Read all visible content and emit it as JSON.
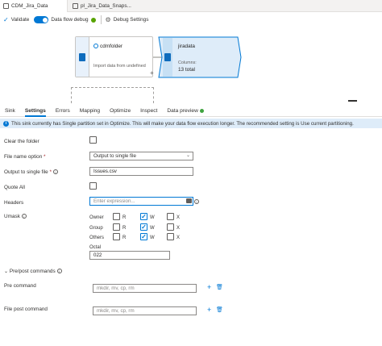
{
  "doc_tabs": [
    {
      "label": "CDM_Jira_Data"
    },
    {
      "label": "pl_Jira_Data_Snaps..."
    }
  ],
  "toolbar": {
    "validate_label": "Validate",
    "data_flow_debug_label": "Data flow debug",
    "debug_settings_label": "Debug Settings"
  },
  "canvas": {
    "source_node": {
      "title": "cdmfolder",
      "subtitle": "Import data from undefined"
    },
    "sink_node": {
      "title": "jiradata",
      "columns_label": "Columns:",
      "columns_value": "13 total"
    },
    "plus_label": "+"
  },
  "panel_tabs": [
    {
      "label": "Sink"
    },
    {
      "label": "Settings"
    },
    {
      "label": "Errors"
    },
    {
      "label": "Mapping"
    },
    {
      "label": "Optimize"
    },
    {
      "label": "Inspect"
    },
    {
      "label": "Data preview"
    }
  ],
  "info_message": "This sink currently has Single partition set in Optimize. This will make your data flow execution longer. The recommended setting is Use current partitioning.",
  "settings": {
    "clear_folder_label": "Clear the folder",
    "file_name_option_label": "File name option",
    "file_name_option_value": "Output to single file",
    "output_single_file_label": "Output to single file",
    "output_single_file_value": "Issues.csv",
    "quote_all_label": "Quote All",
    "headers_label": "Headers",
    "headers_placeholder": "Enter expression...",
    "umask_label": "Umask",
    "umask_rows": [
      {
        "label": "Owner",
        "r": false,
        "w": true,
        "x": false
      },
      {
        "label": "Group",
        "r": false,
        "w": true,
        "x": false
      },
      {
        "label": "Others",
        "r": false,
        "w": true,
        "x": false
      }
    ],
    "r_label": "R",
    "w_label": "W",
    "x_label": "X",
    "octal_label": "Octal",
    "octal_value": "022",
    "pre_post_label": "Pre/post commands",
    "pre_command_label": "Pre command",
    "pre_command_placeholder": "mkdir, mv, cp, rm",
    "post_command_label": "File post command",
    "post_command_placeholder": "mkdir, mv, cp, rm"
  },
  "required_mark": "*"
}
